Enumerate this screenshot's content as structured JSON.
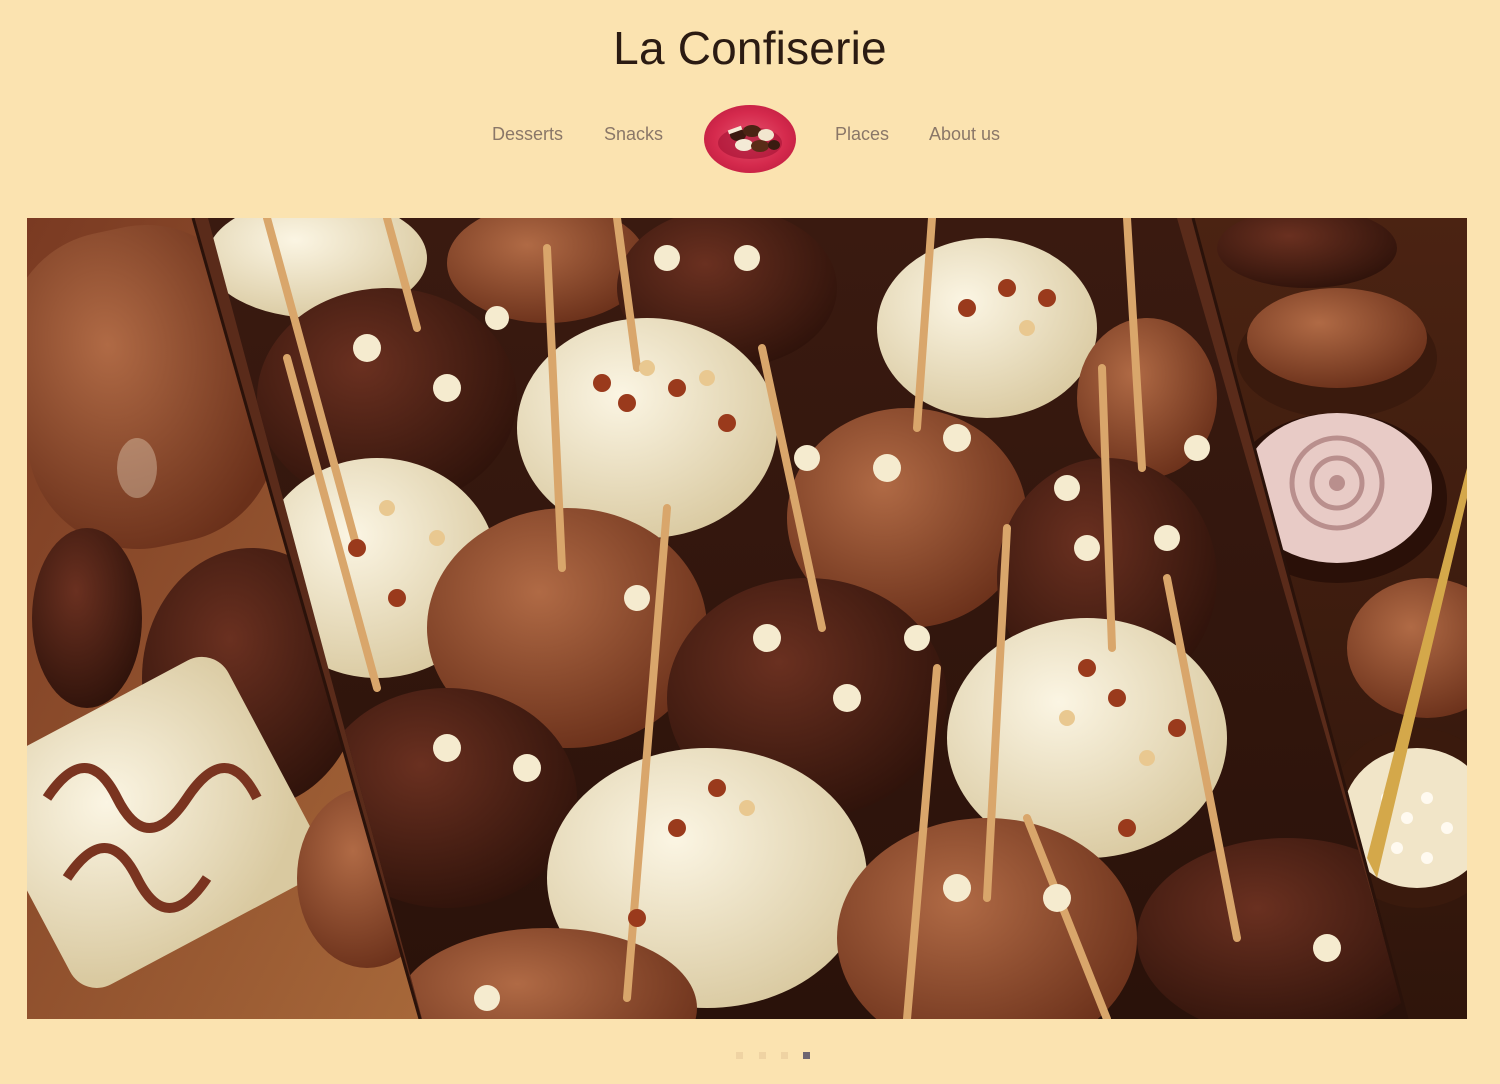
{
  "site": {
    "title": "La Confiserie"
  },
  "nav": {
    "items": [
      {
        "label": "Desserts"
      },
      {
        "label": "Snacks"
      },
      {
        "label": "Places"
      },
      {
        "label": "About us"
      }
    ],
    "logo_icon": "candy-box-logo-icon"
  },
  "slider": {
    "slide_count": 4,
    "active_slide": 4,
    "image_subject": "chocolate candies"
  },
  "colors": {
    "background": "#fbe3b0",
    "title": "#2b1b12",
    "nav_text": "#8a7768",
    "logo_accent": "#d52a4d",
    "dot_inactive": "#efd3a3",
    "dot_active": "#6e6571"
  }
}
